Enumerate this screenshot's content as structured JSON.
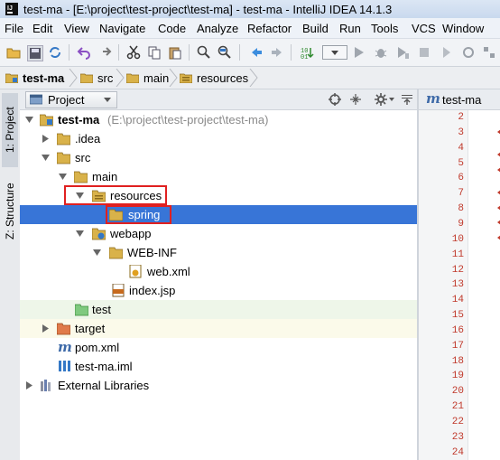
{
  "window": {
    "title": "test-ma - [E:\\project\\test-project\\test-ma] - test-ma - IntelliJ IDEA 14.1.3"
  },
  "menu": [
    "File",
    "Edit",
    "View",
    "Navigate",
    "Code",
    "Analyze",
    "Refactor",
    "Build",
    "Run",
    "Tools",
    "VCS",
    "Window"
  ],
  "toolbar": {
    "icons": [
      "open-folder-icon",
      "save-icon",
      "sync-icon",
      "undo-icon",
      "redo-icon",
      "cut-icon",
      "copy-icon",
      "paste-icon",
      "find-icon",
      "find-replace-icon",
      "back-icon",
      "forward-icon",
      "build-icon",
      "run-config-dropdown",
      "run-icon",
      "debug-icon",
      "coverage-icon",
      "stop-icon"
    ]
  },
  "breadcrumb": [
    "test-ma",
    "src",
    "main",
    "resources"
  ],
  "side_tabs": [
    "1: Project",
    "Z: Structure"
  ],
  "project_panel": {
    "view_label": "Project"
  },
  "tree": [
    {
      "label": "test-ma",
      "suffix": "(E:\\project\\test-project\\test-ma)"
    },
    {
      "label": ".idea"
    },
    {
      "label": "src"
    },
    {
      "label": "main"
    },
    {
      "label": "resources"
    },
    {
      "label": "spring"
    },
    {
      "label": "webapp"
    },
    {
      "label": "WEB-INF"
    },
    {
      "label": "web.xml"
    },
    {
      "label": "index.jsp"
    },
    {
      "label": "test"
    },
    {
      "label": "target"
    },
    {
      "label": "pom.xml"
    },
    {
      "label": "test-ma.iml"
    },
    {
      "label": "External Libraries"
    }
  ],
  "editor": {
    "tab_label": "test-ma",
    "line_numbers": [
      "2",
      "3",
      "4",
      "5",
      "6",
      "7",
      "8",
      "9",
      "10",
      "11",
      "12",
      "13",
      "14",
      "15",
      "16",
      "17",
      "18",
      "19",
      "20",
      "21",
      "22",
      "23",
      "24"
    ]
  },
  "colors": {
    "selection": "#3875d7",
    "highlight_box": "#e02020",
    "test_row": "#eef6e9",
    "target_row": "#fbfaea"
  }
}
